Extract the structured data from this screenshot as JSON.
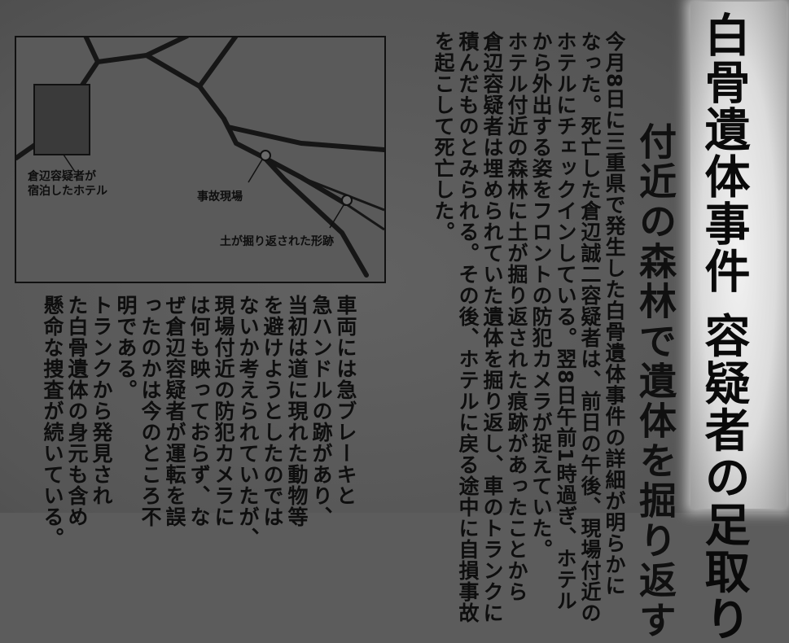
{
  "headline": "白骨遺体事件 容疑者の足取り",
  "subheadline": "付近の森林で遺体を掘り返す",
  "map": {
    "labels": {
      "hotel_line1": "倉辺容疑者が",
      "hotel_line2": "宿泊したホテル",
      "accident": "事故現場",
      "traces": "土が掘り返された形跡"
    }
  },
  "article": {
    "lines": [
      "今月8日に三重県で発生した白骨遺体事件の詳細が明らかに",
      "なった。死亡した倉辺誠二容疑者は、前日の午後、現場付近の",
      "ホテルにチェックインしている。翌8日午前1時過ぎ、ホテル",
      "から外出する姿をフロントの防犯カメラが捉えていた。",
      "ホテル付近の森林に土が掘り返された痕跡があったことから",
      "倉辺容疑者は埋められていた遺体を掘り返し、車のトランクに",
      "積んだものとみられる。その後、ホテルに戻る途中に自損事故",
      "を起こして死亡した。"
    ],
    "lines_lower": [
      "車両には急ブレーキと",
      "急ハンドルの跡があり、",
      "当初は道に現れた動物等",
      "を避けようとしたのでは",
      "ないか考えられていたが、",
      "現場付近の防犯カメラに",
      "は何も映っておらず、な",
      "ぜ倉辺容疑者が運転を誤",
      "ったのかは今のところ不",
      "明である。",
      "トランクから発見され",
      "た白骨遺体の身元も含め",
      "懸命な捜査が続いている。"
    ]
  }
}
